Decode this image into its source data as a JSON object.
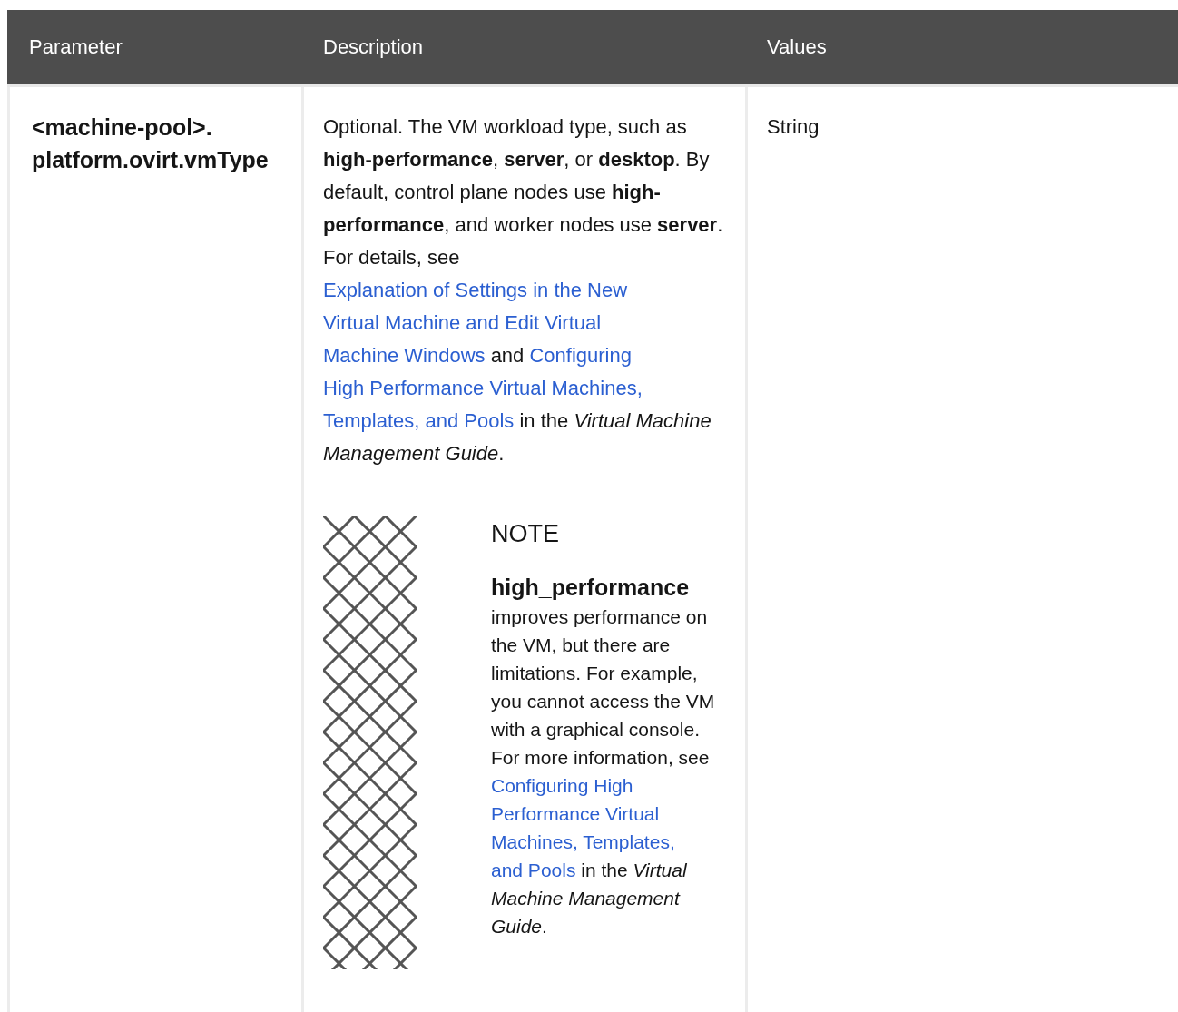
{
  "table": {
    "columns": [
      "Parameter",
      "Description",
      "Values"
    ],
    "rows": [
      {
        "parameter": "<machine-pool>.platform.ovirt.vmType",
        "description": [
          {
            "kind": "text",
            "text": "Optional. The VM workload type, such as "
          },
          {
            "kind": "bold",
            "text": "high-performance"
          },
          {
            "kind": "text",
            "text": ", "
          },
          {
            "kind": "bold",
            "text": "server"
          },
          {
            "kind": "text",
            "text": ", or "
          },
          {
            "kind": "bold",
            "text": "desktop"
          },
          {
            "kind": "text",
            "text": ". By default, control plane nodes use "
          },
          {
            "kind": "bold",
            "text": "high-performance"
          },
          {
            "kind": "text",
            "text": ", and worker nodes use "
          },
          {
            "kind": "bold",
            "text": "server"
          },
          {
            "kind": "text",
            "text": ". For details, see "
          },
          {
            "kind": "link",
            "text": "Explanation of Settings in the New"
          },
          {
            "kind": "link",
            "text": "Virtual Machine and Edit Virtual"
          },
          {
            "kind": "link",
            "text": "Machine Windows"
          },
          {
            "kind": "text",
            "text": " and "
          },
          {
            "kind": "link",
            "text": "Configuring"
          },
          {
            "kind": "link",
            "text": "High Performance Virtual Machines,"
          },
          {
            "kind": "link",
            "text": "Templates, and Pools"
          },
          {
            "kind": "text",
            "text": " in the "
          },
          {
            "kind": "italic",
            "text": "Virtual Machine Management Guide"
          },
          {
            "kind": "text",
            "text": "."
          }
        ],
        "note": {
          "title": "NOTE",
          "term": "high_performance",
          "body": [
            {
              "kind": "text",
              "text": "improves performance on the VM, but there are limitations. For example, you cannot access the VM with a graphical console. For more information, see "
            },
            {
              "kind": "link",
              "text": "Configuring High"
            },
            {
              "kind": "link",
              "text": "Performance Virtual"
            },
            {
              "kind": "link",
              "text": "Machines, Templates,"
            },
            {
              "kind": "link",
              "text": "and Pools"
            },
            {
              "kind": "text",
              "text": " in the "
            },
            {
              "kind": "italic",
              "text": "Virtual Machine Management Guide"
            },
            {
              "kind": "text",
              "text": "."
            }
          ]
        },
        "values": "String"
      }
    ]
  }
}
